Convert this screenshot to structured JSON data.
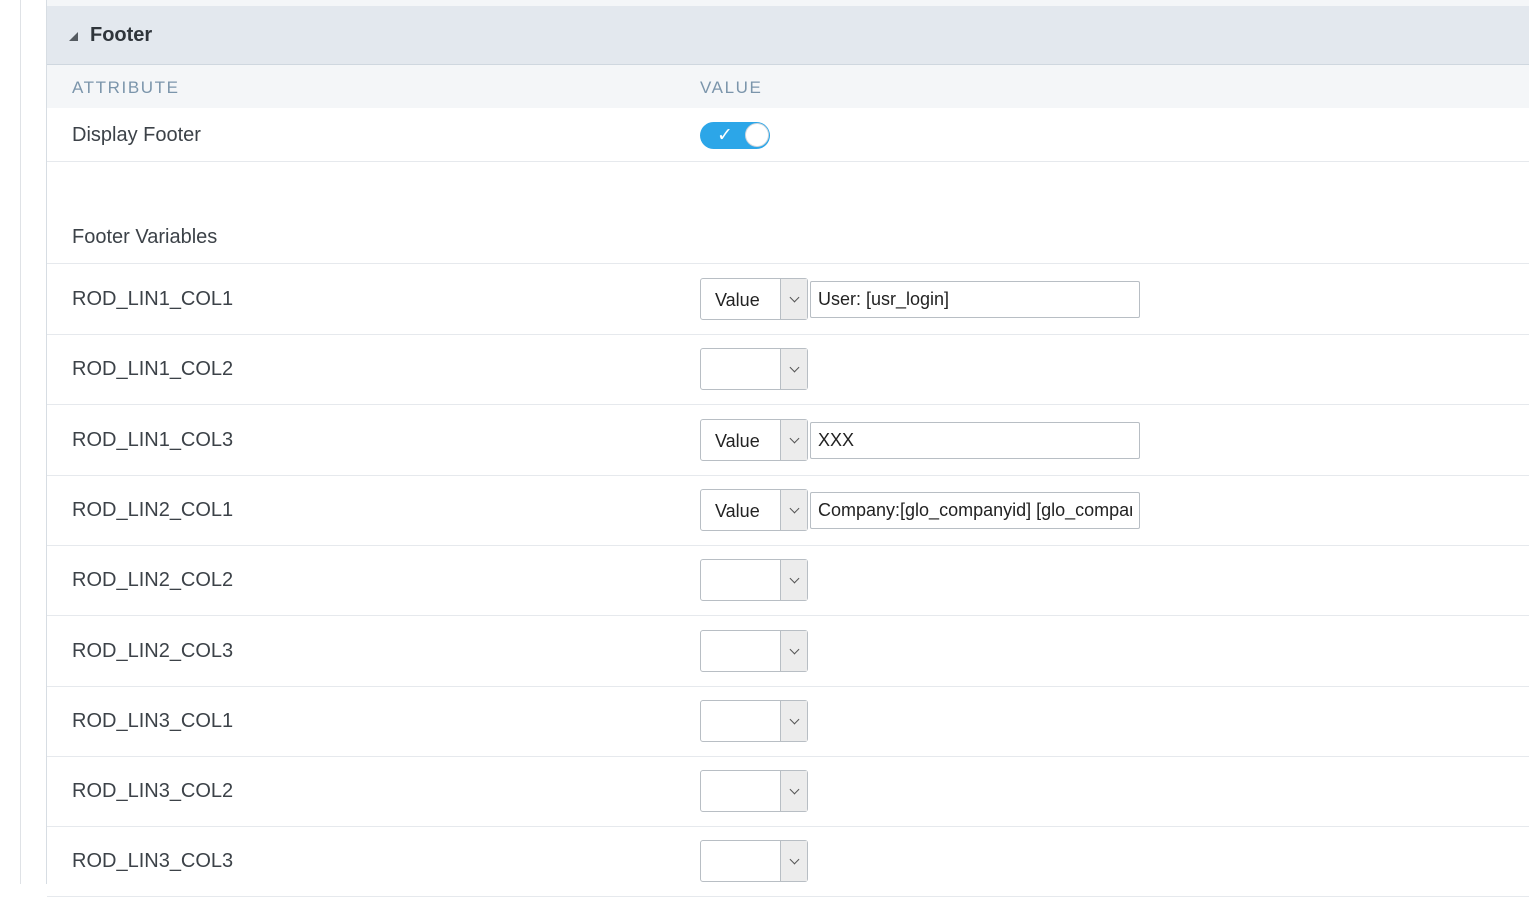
{
  "panel": {
    "title": "Footer"
  },
  "columns": {
    "attribute": "ATTRIBUTE",
    "value": "VALUE"
  },
  "display_footer": {
    "label": "Display Footer",
    "enabled": true,
    "check_glyph": "✓"
  },
  "section": {
    "label": "Footer Variables"
  },
  "variables": [
    {
      "name": "ROD_LIN1_COL1",
      "type": "Value",
      "value": "User: [usr_login]"
    },
    {
      "name": "ROD_LIN1_COL2",
      "type": "",
      "value": null
    },
    {
      "name": "ROD_LIN1_COL3",
      "type": "Value",
      "value": "XXX"
    },
    {
      "name": "ROD_LIN2_COL1",
      "type": "Value",
      "value": "Company:[glo_companyid] [glo_company]"
    },
    {
      "name": "ROD_LIN2_COL2",
      "type": "",
      "value": null
    },
    {
      "name": "ROD_LIN2_COL3",
      "type": "",
      "value": null
    },
    {
      "name": "ROD_LIN3_COL1",
      "type": "",
      "value": null
    },
    {
      "name": "ROD_LIN3_COL2",
      "type": "",
      "value": null
    },
    {
      "name": "ROD_LIN3_COL3",
      "type": "",
      "value": null
    }
  ],
  "colors": {
    "accent": "#2ca6e8",
    "header_bg": "#e3e8ee",
    "column_header_text": "#7b95ab"
  }
}
